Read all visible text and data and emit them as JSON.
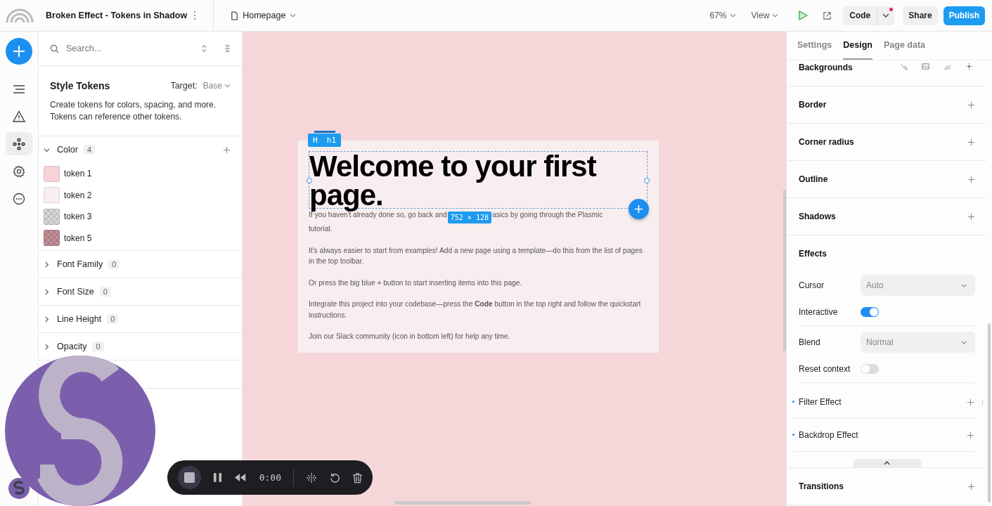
{
  "top_bar": {
    "project_title": "Broken Effect - Tokens in Shadow",
    "page": "Homepage",
    "zoom": "67%",
    "view": "View",
    "code_button": "Code",
    "code_notification": true,
    "share_button": "Share",
    "publish_button": "Publish"
  },
  "left_rail": [
    {
      "kind": "outline",
      "selected": false
    },
    {
      "kind": "warning",
      "selected": false
    },
    {
      "kind": "tokens",
      "selected": true
    },
    {
      "kind": "settings",
      "selected": false
    },
    {
      "kind": "more",
      "selected": false
    }
  ],
  "tokens_panel": {
    "search": {
      "placeholder": "Search..."
    },
    "title": "Style Tokens",
    "target_label": "Target:",
    "target_value": "Base",
    "description": "Create tokens for colors, spacing, and more. Tokens can reference other tokens.",
    "groups": [
      {
        "name": "Color",
        "count": "4",
        "expanded": true,
        "tokens": [
          {
            "name": "token 1",
            "color": "#f5d3d6",
            "transparent": false
          },
          {
            "name": "token 2",
            "color": "#f8eeef",
            "transparent": false
          },
          {
            "name": "token 3",
            "color": "#d9d9d9",
            "transparent": true
          },
          {
            "name": "token 5",
            "color": "#c58f97",
            "transparent": true
          }
        ]
      },
      {
        "name": "Font Family",
        "count": "0",
        "expanded": false
      },
      {
        "name": "Font Size",
        "count": "0",
        "expanded": false
      },
      {
        "name": "Line Height",
        "count": "0",
        "expanded": false
      },
      {
        "name": "Opacity",
        "count": "0",
        "expanded": false
      }
    ]
  },
  "canvas": {
    "element_glyph": "H",
    "element_tag": "h1",
    "heading": "Welcome to your first page.",
    "size_label": "752 × 128",
    "first_paragraph_parts": [
      "If you haven't already done so, go back and",
      "asics by going through the Plasmic",
      "tutorial."
    ],
    "paragraphs": [
      "It's always easier to start from examples! Add a new page using a template—do this from the list of pages in the top toolbar.",
      "Or press the big blue + button to start inserting items into this page.",
      "Integrate this project into your codebase—press the **Code** button in the top right and follow the quickstart instructions.",
      "Join our Slack community (icon in bottom left) for help any time."
    ]
  },
  "design_panel": {
    "tabs": [
      {
        "label": "Settings",
        "selected": false
      },
      {
        "label": "Design",
        "selected": true
      },
      {
        "label": "Page data",
        "selected": false
      }
    ],
    "sections": [
      {
        "kind": "icons",
        "title": "Backgrounds"
      },
      {
        "kind": "add",
        "title": "Border"
      },
      {
        "kind": "add",
        "title": "Corner radius"
      },
      {
        "kind": "add",
        "title": "Outline"
      },
      {
        "kind": "add",
        "title": "Shadows"
      },
      {
        "kind": "effects",
        "title": "Effects",
        "rows": [
          {
            "kind": "select",
            "label": "Cursor",
            "value": "Auto"
          },
          {
            "kind": "toggle",
            "label": "Interactive",
            "on": true
          },
          {
            "kind": "select",
            "label": "Blend",
            "value": "Normal"
          },
          {
            "kind": "toggle",
            "label": "Reset context",
            "on": false
          },
          {
            "kind": "add",
            "label": "Filter Effect",
            "hovered": true
          },
          {
            "kind": "add",
            "label": "Backdrop Effect",
            "hovered": false
          }
        ]
      },
      {
        "kind": "add",
        "title": "Transitions"
      }
    ]
  },
  "recorder": {
    "time": "0:00"
  }
}
